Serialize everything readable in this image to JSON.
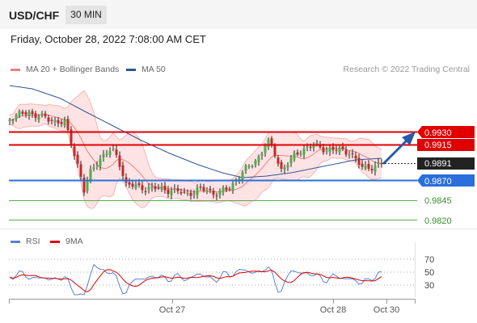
{
  "header": {
    "pair": "USD/CHF",
    "timeframe": "30 MIN"
  },
  "timestamp": "Friday, October 28, 2022 7:08:00 AM CET",
  "legend": {
    "ma20": {
      "label": "MA 20 + Bollinger Bands",
      "color": "#f08080"
    },
    "ma50": {
      "label": "MA 50",
      "color": "#2f5597"
    }
  },
  "credit": "Research © 2022 Trading Central",
  "price_levels": [
    {
      "label": "0.9930",
      "kind": "resistance"
    },
    {
      "label": "0.9915",
      "kind": "resistance"
    },
    {
      "label": "0.9891",
      "kind": "current"
    },
    {
      "label": "0.9870",
      "kind": "pivot"
    },
    {
      "label": "0.9845",
      "kind": "support"
    },
    {
      "label": "0.9820",
      "kind": "support"
    }
  ],
  "rsi_panel": {
    "legend": {
      "rsi": "RSI",
      "ma": "9MA"
    },
    "levels": [
      "70",
      "50",
      "30"
    ]
  },
  "x_axis": [
    "Oct 27",
    "Oct 28",
    "Oct 30"
  ],
  "colors": {
    "resistance": "#e00000",
    "pivot": "#2a6fdb",
    "support": "#5aab4f",
    "current": "#222222",
    "arrow": "#2a5aa8",
    "candle_up": "#4caf50",
    "candle_down": "#c62828"
  }
}
